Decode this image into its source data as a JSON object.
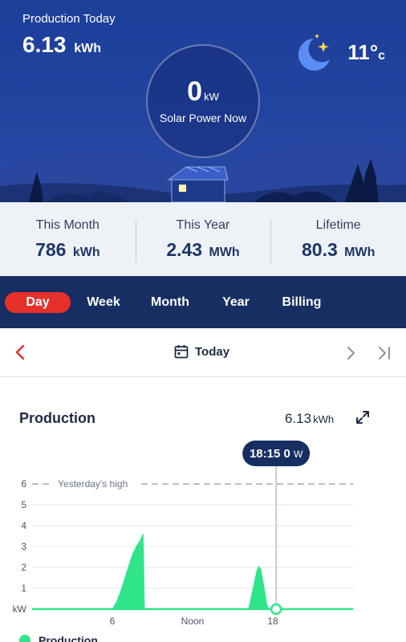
{
  "hero": {
    "production_today_label": "Production Today",
    "production_today_value": "6.13",
    "production_today_unit": "kWh",
    "temperature_value": "11°",
    "temperature_unit": "c",
    "weather_icon": "moon-stars-icon",
    "power_now_value": "0",
    "power_now_unit": "kW",
    "power_now_label": "Solar Power Now"
  },
  "stats": [
    {
      "label": "This Month",
      "value": "786",
      "unit": "kWh"
    },
    {
      "label": "This Year",
      "value": "2.43",
      "unit": "MWh"
    },
    {
      "label": "Lifetime",
      "value": "80.3",
      "unit": "MWh"
    }
  ],
  "tabs": [
    {
      "label": "Day",
      "active": true
    },
    {
      "label": "Week",
      "active": false
    },
    {
      "label": "Month",
      "active": false
    },
    {
      "label": "Year",
      "active": false
    },
    {
      "label": "Billing",
      "active": false
    }
  ],
  "date_nav": {
    "prev_icon": "chevron-left-icon",
    "calendar_icon": "calendar-icon",
    "label": "Today",
    "next_icon": "chevron-right-icon",
    "last_icon": "skip-to-end-icon"
  },
  "card": {
    "title": "Production",
    "total_value": "6.13",
    "total_unit": "kWh",
    "expand_icon": "expand-icon"
  },
  "colors": {
    "accent_red": "#e5302a",
    "production_green": "#2ee58a",
    "nav_blue": "#172e62",
    "hero_blue": "#1d3f9a"
  },
  "chart_data": {
    "type": "area",
    "ylabel": "kW",
    "ylim": [
      0,
      6
    ],
    "xlim": [
      0,
      24
    ],
    "y_ticks": [
      "6",
      "5",
      "4",
      "3",
      "2",
      "1",
      "kW"
    ],
    "x_ticks": [
      {
        "x": 6,
        "label": "6"
      },
      {
        "x": 12,
        "label": "Noon"
      },
      {
        "x": 18,
        "label": "18"
      }
    ],
    "reference_line": {
      "label": "Yesterday's high",
      "y": 6
    },
    "grid": true,
    "series": [
      {
        "name": "Production",
        "color": "#2ee58a",
        "points": [
          [
            0,
            0
          ],
          [
            6.0,
            0
          ],
          [
            6.3,
            0.3
          ],
          [
            6.6,
            0.8
          ],
          [
            6.9,
            1.4
          ],
          [
            7.2,
            2.0
          ],
          [
            7.5,
            2.6
          ],
          [
            7.8,
            3.0
          ],
          [
            8.1,
            3.3
          ],
          [
            8.3,
            3.6
          ],
          [
            8.4,
            0
          ],
          [
            16.2,
            0
          ],
          [
            16.5,
            0.9
          ],
          [
            16.8,
            1.8
          ],
          [
            16.95,
            2.05
          ],
          [
            17.1,
            1.9
          ],
          [
            17.35,
            1.0
          ],
          [
            17.55,
            0.2
          ],
          [
            17.7,
            0
          ],
          [
            24,
            0
          ]
        ]
      }
    ],
    "cursor": {
      "x": 18.25,
      "time": "18:15",
      "value": "0",
      "unit": "W"
    }
  }
}
